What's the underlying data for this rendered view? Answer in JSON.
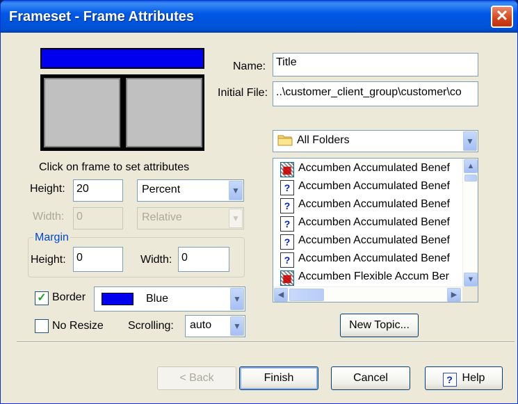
{
  "window": {
    "title": "Frameset - Frame Attributes",
    "close_glyph": "✕"
  },
  "preview": {
    "hint": "Click on frame to set attributes",
    "top_frame_color": "#0000ee"
  },
  "height": {
    "label": "Height:",
    "value": "20",
    "unit": "Percent"
  },
  "width": {
    "label": "Width:",
    "value": "0",
    "unit": "Relative"
  },
  "margin": {
    "title": "Margin",
    "height_label": "Height:",
    "height_value": "0",
    "width_label": "Width:",
    "width_value": "0"
  },
  "border": {
    "label": "Border",
    "checked": true,
    "color_name": "Blue",
    "color_hex": "#0000ee"
  },
  "no_resize": {
    "label": "No Resize",
    "checked": false
  },
  "scrolling": {
    "label": "Scrolling:",
    "value": "auto"
  },
  "name": {
    "label": "Name:",
    "value": "Title"
  },
  "initial_file": {
    "label": "Initial File:",
    "value": "..\\customer_client_group\\customer\\co"
  },
  "folders": {
    "selected": "All Folders"
  },
  "topics": [
    {
      "label": "Accumben Accumulated Benef",
      "icon": "frameset-icon"
    },
    {
      "label": "Accumben Accumulated Benef",
      "icon": "topic-icon"
    },
    {
      "label": "Accumben Accumulated Benef",
      "icon": "topic-icon"
    },
    {
      "label": "Accumben Accumulated Benef",
      "icon": "topic-icon"
    },
    {
      "label": "Accumben Accumulated Benef",
      "icon": "topic-icon"
    },
    {
      "label": "Accumben Accumulated Benef",
      "icon": "topic-icon"
    },
    {
      "label": "Accumben Flexible Accum Ber",
      "icon": "frameset-icon"
    }
  ],
  "buttons": {
    "new_topic": "New Topic...",
    "back": "< Back",
    "finish": "Finish",
    "cancel": "Cancel",
    "help": "Help"
  }
}
